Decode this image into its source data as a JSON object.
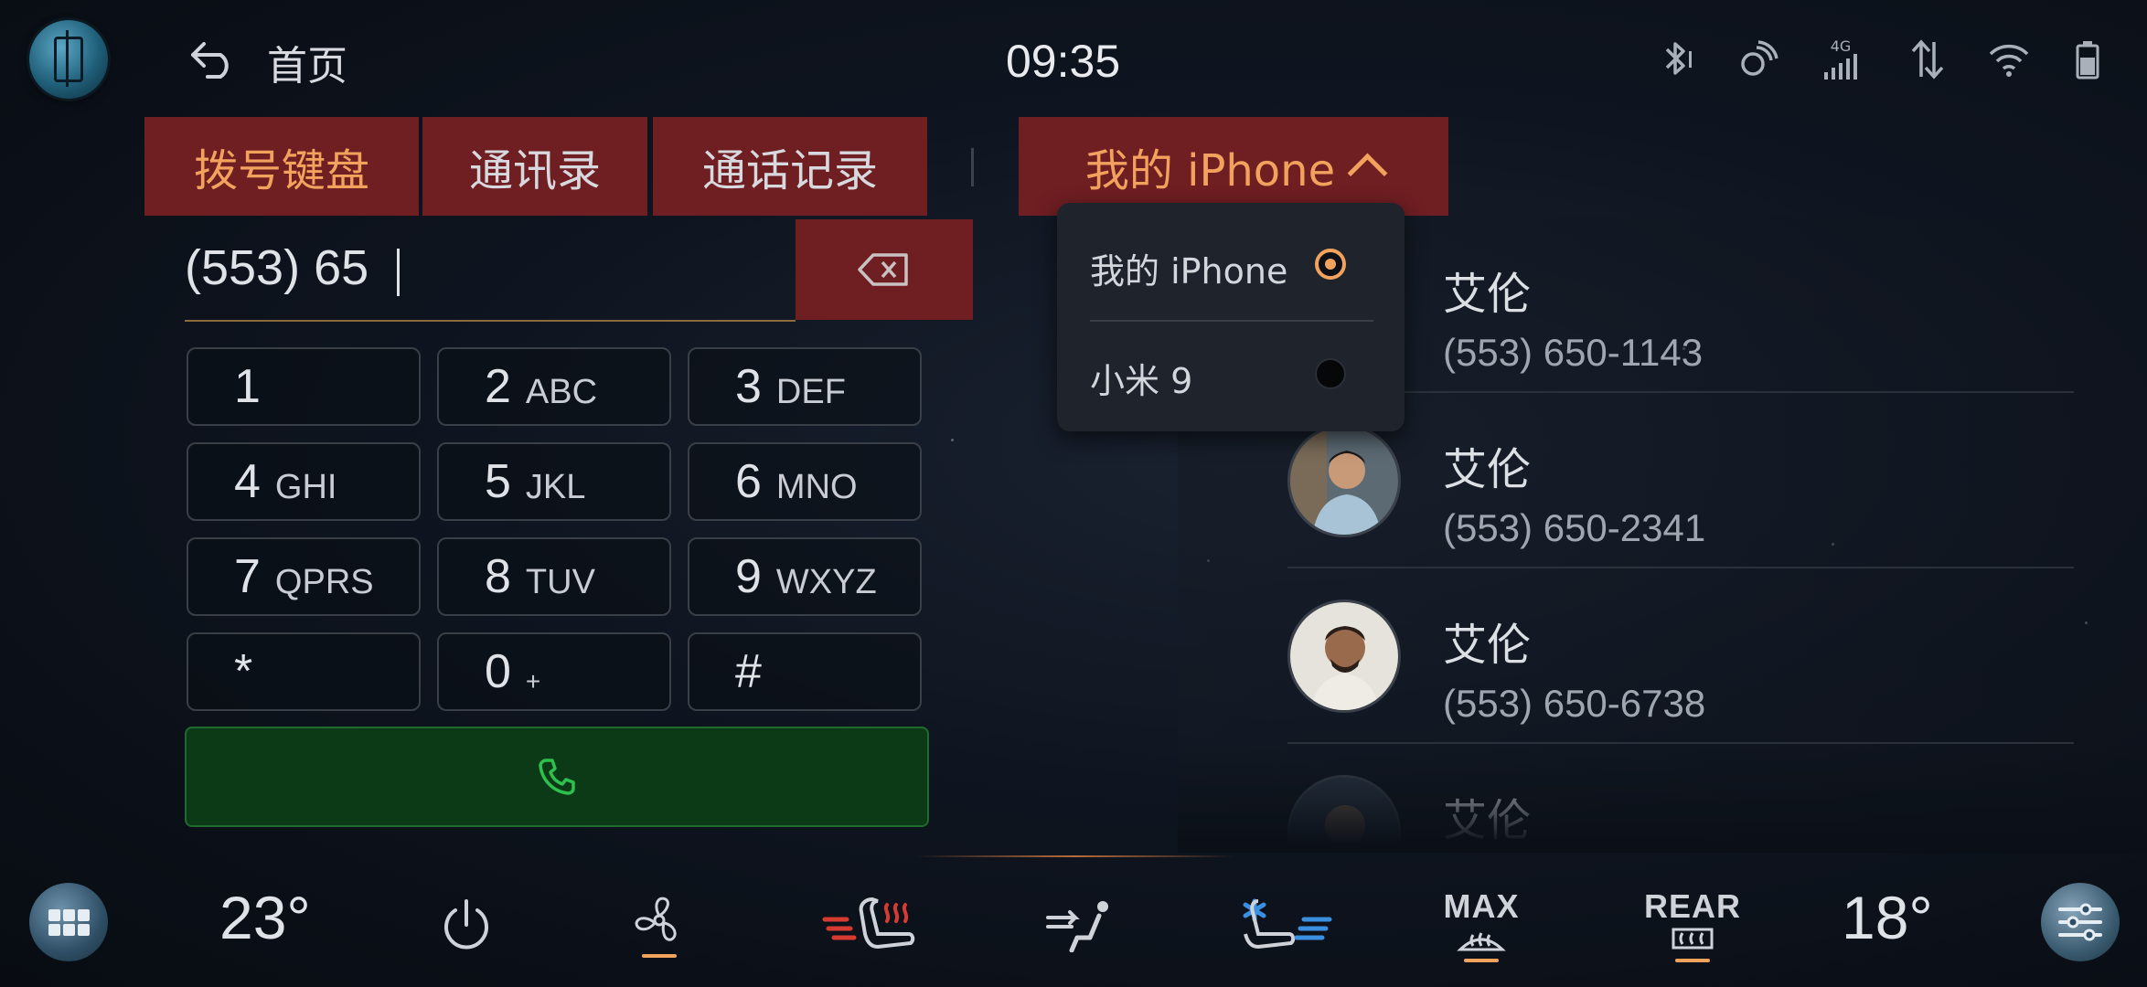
{
  "status_bar": {
    "back_title": "首页",
    "time": "09:35",
    "signal_label": "4G"
  },
  "tabs": [
    {
      "label": "拨号键盘",
      "active": true
    },
    {
      "label": "通讯录",
      "active": false
    },
    {
      "label": "通话记录",
      "active": false
    }
  ],
  "device_selector": {
    "label": "我的 iPhone",
    "options": [
      {
        "label": "我的 iPhone",
        "selected": true
      },
      {
        "label": "小米 9",
        "selected": false
      }
    ]
  },
  "dialer": {
    "input_value": "(553) 65",
    "keys": [
      {
        "digit": "1",
        "letters": ""
      },
      {
        "digit": "2",
        "letters": "ABC"
      },
      {
        "digit": "3",
        "letters": "DEF"
      },
      {
        "digit": "4",
        "letters": "GHI"
      },
      {
        "digit": "5",
        "letters": "JKL"
      },
      {
        "digit": "6",
        "letters": "MNO"
      },
      {
        "digit": "7",
        "letters": "QPRS"
      },
      {
        "digit": "8",
        "letters": "TUV"
      },
      {
        "digit": "9",
        "letters": "WXYZ"
      },
      {
        "digit": "*",
        "letters": ""
      },
      {
        "digit": "0",
        "letters": "+"
      },
      {
        "digit": "#",
        "letters": ""
      }
    ]
  },
  "contacts": [
    {
      "name": "艾伦",
      "number": "(553) 650-1143"
    },
    {
      "name": "艾伦",
      "number": "(553) 650-2341"
    },
    {
      "name": "艾伦",
      "number": "(553) 650-6738"
    },
    {
      "name": "艾伦",
      "number": ""
    }
  ],
  "climate": {
    "left_temp": "23°",
    "right_temp": "18°",
    "max_label": "MAX",
    "rear_label": "REAR"
  },
  "colors": {
    "accent": "#f1a25d",
    "tab_bg": "#6f1e22",
    "call_green": "#2ec04f"
  }
}
